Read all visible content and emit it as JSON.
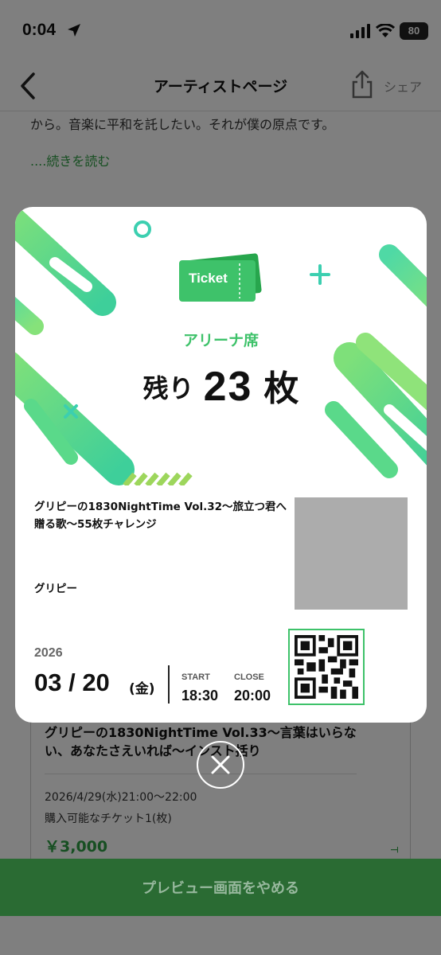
{
  "status_bar": {
    "time": "0:04",
    "battery": "80"
  },
  "nav": {
    "title": "アーティストページ",
    "share_label": "シェア"
  },
  "background": {
    "intro_text": "から。音楽に平和を託したい。それが僕の原点です。",
    "read_more": "....続きを読む",
    "next_event": {
      "title": "グリピーの1830NightTime Vol.33～言葉はいらない、あなたさえいれば～インスト括り",
      "datetime": "2026/4/29(水)21:00～22:00",
      "available": "購入可能なチケット1(枚)",
      "price": "￥3,000",
      "side_label": "T"
    }
  },
  "ticket": {
    "badge_label": "Ticket",
    "seat_type": "アリーナ席",
    "remaining_label": "残り",
    "remaining_count": "23",
    "remaining_unit": "枚",
    "event_title": "グリピーの1830NightTime Vol.32～旅立つ君へ贈る歌～55枚チャレンジ",
    "artist": "グリピー",
    "year": "2026",
    "date": "03 / 20",
    "day_of_week": "(金)",
    "start_label": "START",
    "start_time": "18:30",
    "close_label": "CLOSE",
    "close_time": "20:00"
  },
  "bottom_bar": {
    "label": "プレビュー画面をやめる"
  },
  "colors": {
    "accent_green": "#3ec26a",
    "bottom_bar": "#2a6b33",
    "price_green": "#2f9e44"
  }
}
